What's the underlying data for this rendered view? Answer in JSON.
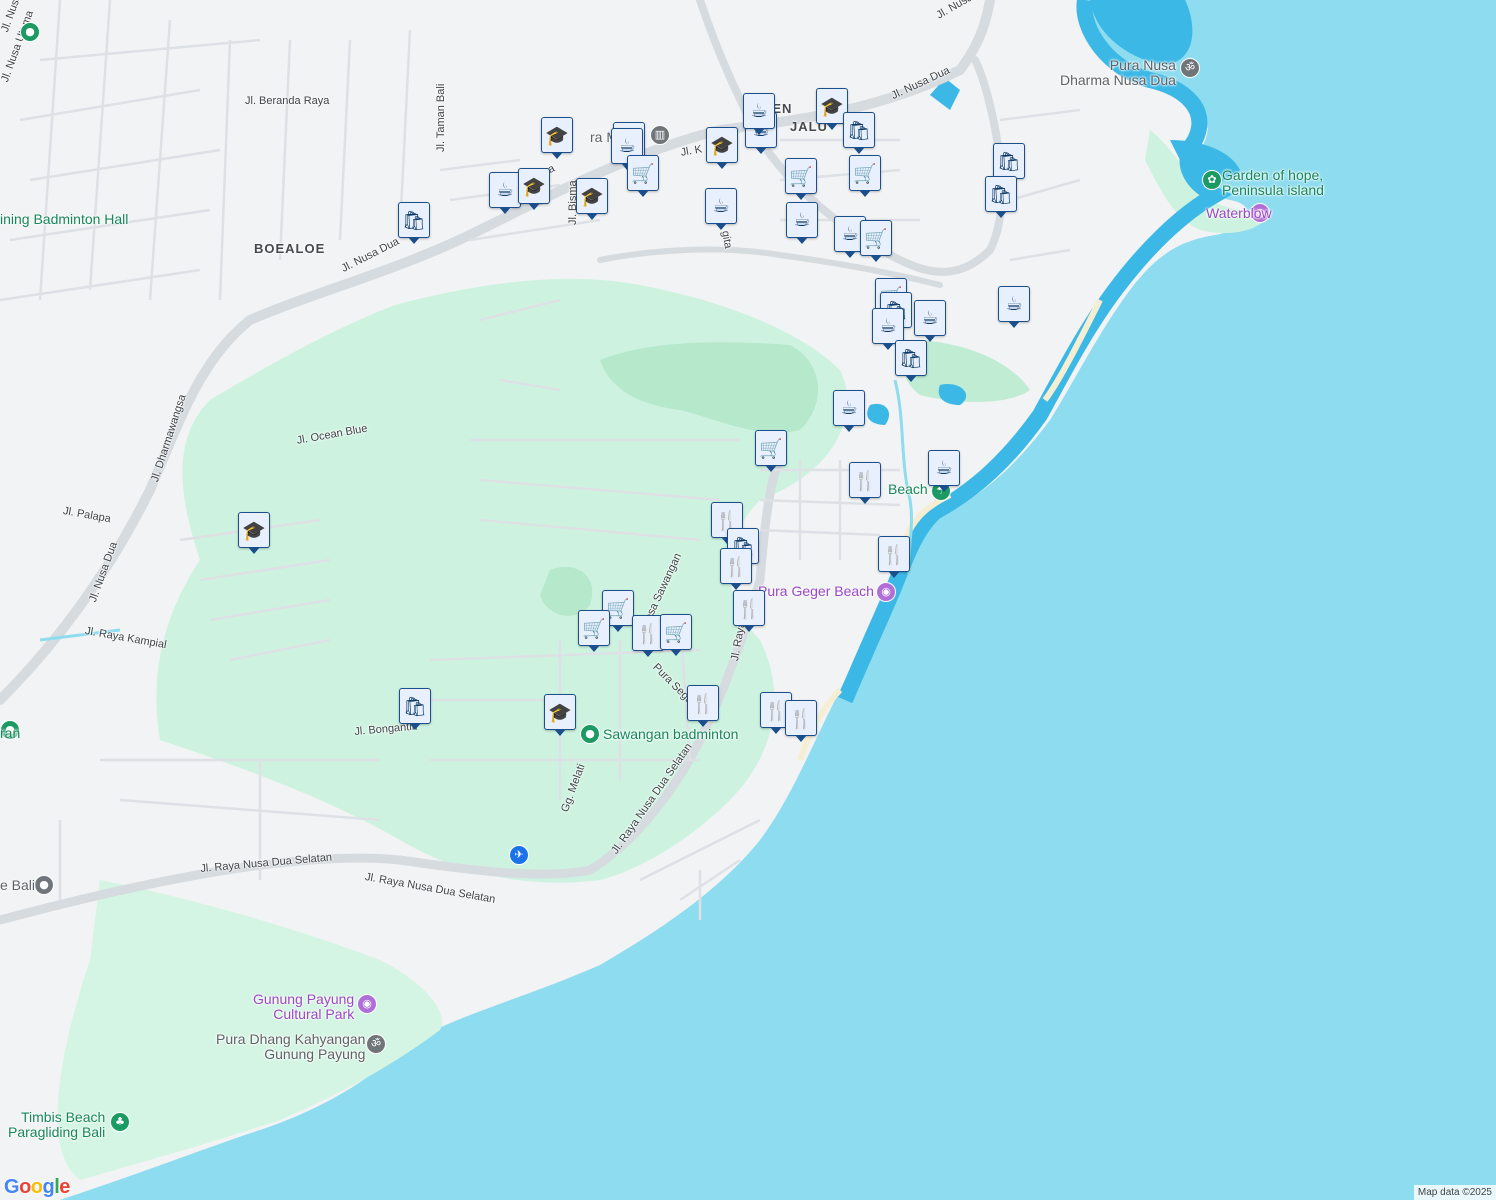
{
  "map": {
    "attribution": "Map data ©2025",
    "logo": "Google",
    "colors": {
      "sea": "#8edcef",
      "deep_water": "#3cb8e6",
      "land": "#f2f3f4",
      "park": "#cdf3e0",
      "road": "#d6dbe0",
      "marker_border": "#1a4f8c"
    }
  },
  "road_labels": [
    {
      "text": "Jl. Nusa Dua"
    },
    {
      "text": "Jl. Beranda Raya"
    },
    {
      "text": "Jl. Taman Bali"
    },
    {
      "text": "Jl. Nusa Dua"
    },
    {
      "text": "Jl. Nusa Dua"
    },
    {
      "text": "Jl. Bisma"
    },
    {
      "text": "Jl. Dharmawangsa"
    },
    {
      "text": "Jl. Ocean Blue"
    },
    {
      "text": "Jl. Palapa"
    },
    {
      "text": "Jl. Nusa Dua"
    },
    {
      "text": "Jl. Raya Kampial"
    },
    {
      "text": "Jl. Bongantik"
    },
    {
      "text": "Gg. Melati"
    },
    {
      "text": "Jl. Raya Nusa Dua Selatan"
    },
    {
      "text": "Jl. Raya Nusa Dua Selatan"
    },
    {
      "text": "Jl. Raya Nusa Dua Selatan"
    },
    {
      "text": "Desa Sawangan"
    },
    {
      "text": "Pura Segara"
    },
    {
      "text": "Jl. Raya"
    },
    {
      "text": "Jl. Nusa Dua"
    },
    {
      "text": "Jl. K"
    },
    {
      "text": "gita"
    },
    {
      "text": "Jl. Nusa Dua"
    },
    {
      "text": "Jl. Nusa Utama"
    }
  ],
  "area_labels": [
    {
      "text": "BOEALOE"
    },
    {
      "text": "BEN"
    },
    {
      "text": "JALU"
    }
  ],
  "places": [
    {
      "name": "Pura Nusa\nDharma Nusa Dua",
      "color": "gray",
      "icon": "om"
    },
    {
      "name": "Garden of hope,\nPeninsula island",
      "color": "green",
      "icon": "flower"
    },
    {
      "name": "Waterblow",
      "color": "purple",
      "icon": "camera"
    },
    {
      "name": "Pura Geger Beach",
      "color": "purple",
      "icon": "camera"
    },
    {
      "name": "Beach",
      "color": "green",
      "icon": "beach"
    },
    {
      "name": "Sawangan badminton",
      "color": "green",
      "icon": "sport"
    },
    {
      "name": "Gunung Payung\nCultural Park",
      "color": "purple",
      "icon": "camera"
    },
    {
      "name": "Pura Dhang Kahyangan\nGunung Payung",
      "color": "gray",
      "icon": "om"
    },
    {
      "name": "Timbis Beach\nParagliding Bali",
      "color": "green",
      "icon": "tree"
    },
    {
      "name": "ining Badminton Hall",
      "color": "green",
      "icon": "sport"
    },
    {
      "name": "ra Ma",
      "color": "gray",
      "icon": "museum"
    },
    {
      "name": "e Bali",
      "color": "gray",
      "icon": "pin"
    },
    {
      "name": "ran",
      "color": "green",
      "icon": "sport"
    }
  ],
  "poi_markers": [
    {
      "type": "cafe"
    },
    {
      "type": "school"
    },
    {
      "type": "school"
    },
    {
      "type": "shopping"
    },
    {
      "type": "school"
    },
    {
      "type": "cafe"
    },
    {
      "type": "cafe"
    },
    {
      "type": "grocery"
    },
    {
      "type": "school"
    },
    {
      "type": "cafe"
    },
    {
      "type": "cafe"
    },
    {
      "type": "school"
    },
    {
      "type": "shopping"
    },
    {
      "type": "grocery"
    },
    {
      "type": "grocery"
    },
    {
      "type": "cafe"
    },
    {
      "type": "cafe"
    },
    {
      "type": "cafe"
    },
    {
      "type": "grocery"
    },
    {
      "type": "shopping"
    },
    {
      "type": "shopping"
    },
    {
      "type": "grocery"
    },
    {
      "type": "shopping"
    },
    {
      "type": "cafe"
    },
    {
      "type": "cafe"
    },
    {
      "type": "cafe"
    },
    {
      "type": "shopping"
    },
    {
      "type": "cafe"
    },
    {
      "type": "grocery"
    },
    {
      "type": "restaurant"
    },
    {
      "type": "cafe"
    },
    {
      "type": "school"
    },
    {
      "type": "restaurant"
    },
    {
      "type": "shopping"
    },
    {
      "type": "restaurant"
    },
    {
      "type": "restaurant"
    },
    {
      "type": "restaurant"
    },
    {
      "type": "grocery"
    },
    {
      "type": "grocery"
    },
    {
      "type": "restaurant"
    },
    {
      "type": "grocery"
    },
    {
      "type": "shopping"
    },
    {
      "type": "school"
    },
    {
      "type": "restaurant"
    },
    {
      "type": "restaurant"
    },
    {
      "type": "restaurant"
    }
  ],
  "icons": {
    "cafe": "☕",
    "school": "🎓",
    "shopping": "🛍",
    "grocery": "🛒",
    "restaurant": "🍴",
    "om": "ॐ",
    "flower": "✿",
    "camera": "◉",
    "beach": "☂",
    "sport": "●",
    "tree": "♣",
    "museum": "▥",
    "pin": "●",
    "airport": "✈"
  }
}
